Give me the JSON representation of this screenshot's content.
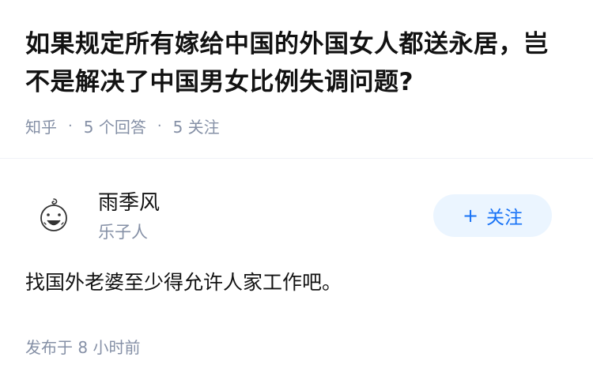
{
  "question": {
    "title": "如果规定所有嫁给中国的外国女人都送永居，岂不是解决了中国男女比例失调问题?",
    "source": "知乎",
    "separator": "·",
    "answer_count": "5 个回答",
    "follower_count": "5 关注"
  },
  "answer": {
    "author": {
      "name": "雨季风",
      "bio": "乐子人",
      "avatar_icon": "doodle-face-avatar"
    },
    "follow_button": {
      "icon": "+",
      "label": "关注"
    },
    "content": "找国外老婆至少得允许人家工作吧。",
    "published": "发布于 8 小时前"
  },
  "colors": {
    "text": "#121212",
    "meta": "#8590a6",
    "follow_bg": "#ebf5ff",
    "follow_text": "#1772f6"
  }
}
